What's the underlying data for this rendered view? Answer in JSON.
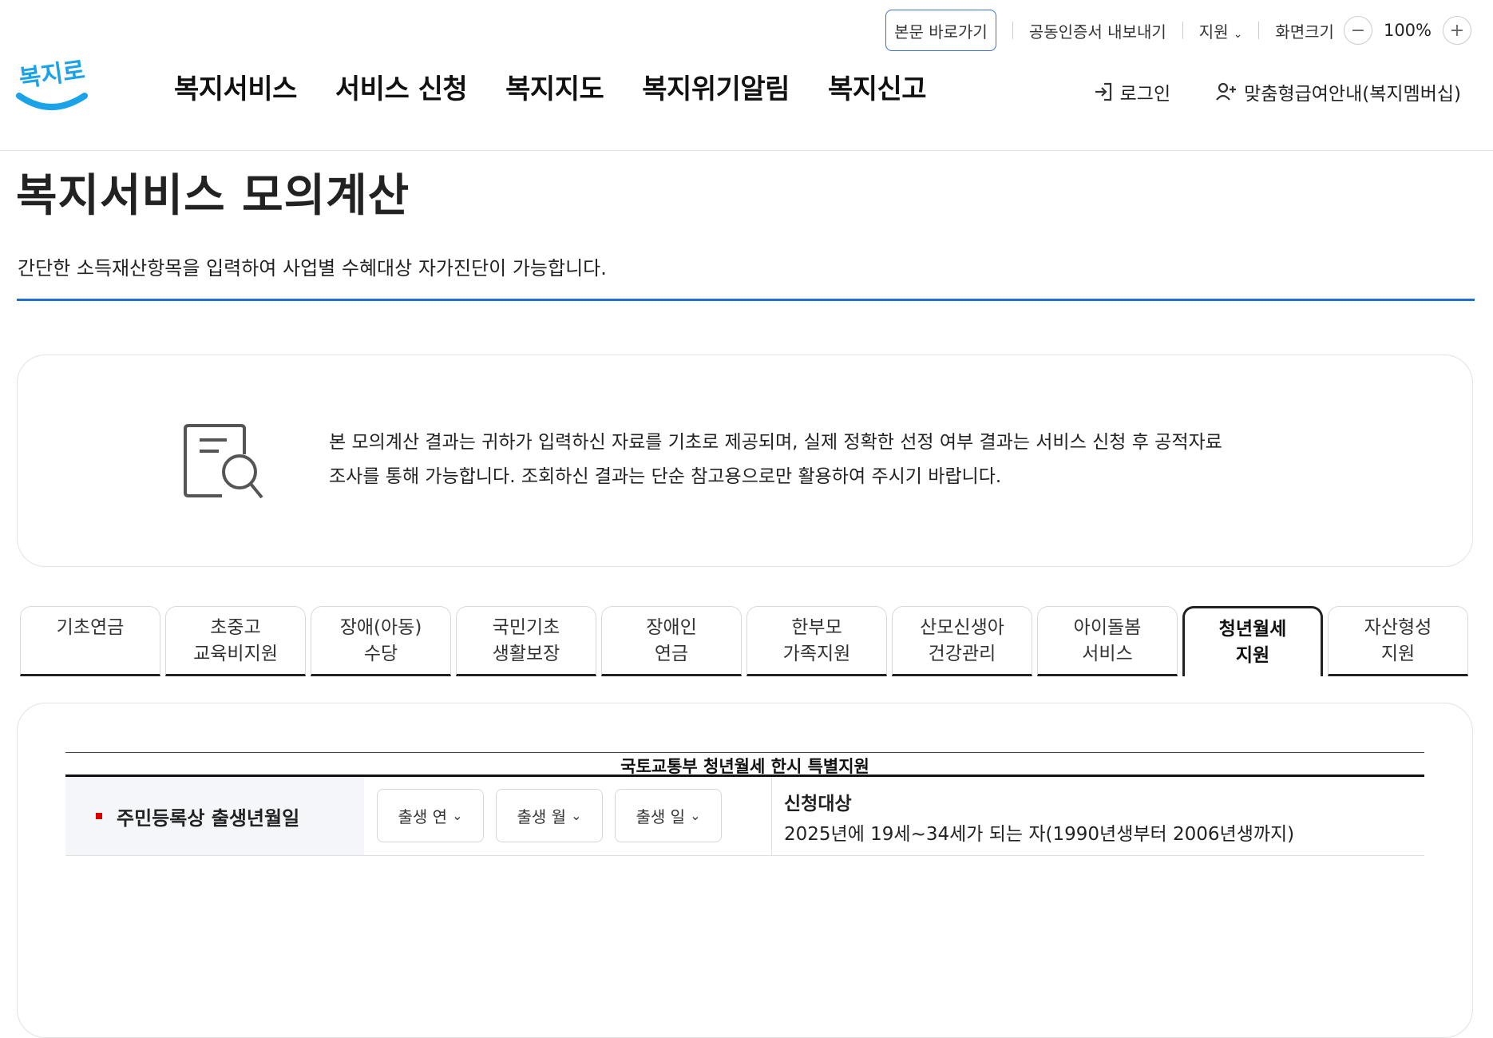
{
  "utility": {
    "skip_label": "본문 바로가기",
    "cert_export": "공동인증서 내보내기",
    "support": "지원",
    "screen_size": "화면크기",
    "zoom_level": "100%"
  },
  "logo": {
    "text": "복지로"
  },
  "nav": {
    "items": [
      "복지서비스",
      "서비스 신청",
      "복지지도",
      "복지위기알림",
      "복지신고"
    ]
  },
  "header": {
    "login": "로그인",
    "membership": "맞춤형급여안내(복지멤버십)"
  },
  "page": {
    "title": "복지서비스 모의계산",
    "description": "간단한 소득재산항목을 입력하여 사업별 수혜대상 자가진단이 가능합니다."
  },
  "notice": {
    "line1": "본 모의계산 결과는 귀하가 입력하신 자료를 기초로 제공되며, 실제 정확한 선정 여부 결과는 서비스 신청 후 공적자료",
    "line2": "조사를 통해 가능합니다. 조회하신 결과는 단순 참고용으로만 활용하여 주시기 바랍니다."
  },
  "tabs": [
    {
      "label": "기초연금",
      "active": false
    },
    {
      "label": "초중고\n교육비지원",
      "active": false
    },
    {
      "label": "장애(아동)\n수당",
      "active": false
    },
    {
      "label": "국민기초\n생활보장",
      "active": false
    },
    {
      "label": "장애인\n연금",
      "active": false
    },
    {
      "label": "한부모\n가족지원",
      "active": false
    },
    {
      "label": "산모신생아\n건강관리",
      "active": false
    },
    {
      "label": "아이돌봄\n서비스",
      "active": false
    },
    {
      "label": "청년월세\n지원",
      "active": true
    },
    {
      "label": "자산형성\n지원",
      "active": false
    }
  ],
  "form": {
    "table_title": "국토교통부 청년월세 한시 특별지원",
    "row_label": "주민등록상 출생년월일",
    "year_select": "출생 연",
    "month_select": "출생 월",
    "day_select": "출생 일",
    "eligibility_label": "신청대상",
    "eligibility_value": "2025년에 19세~34세가 되는 자(1990년생부터 2006년생까지)"
  },
  "colors": {
    "accent_blue": "#1f6fd1",
    "logo_blue": "#1aa3e8",
    "bullet_red": "#d90000"
  }
}
